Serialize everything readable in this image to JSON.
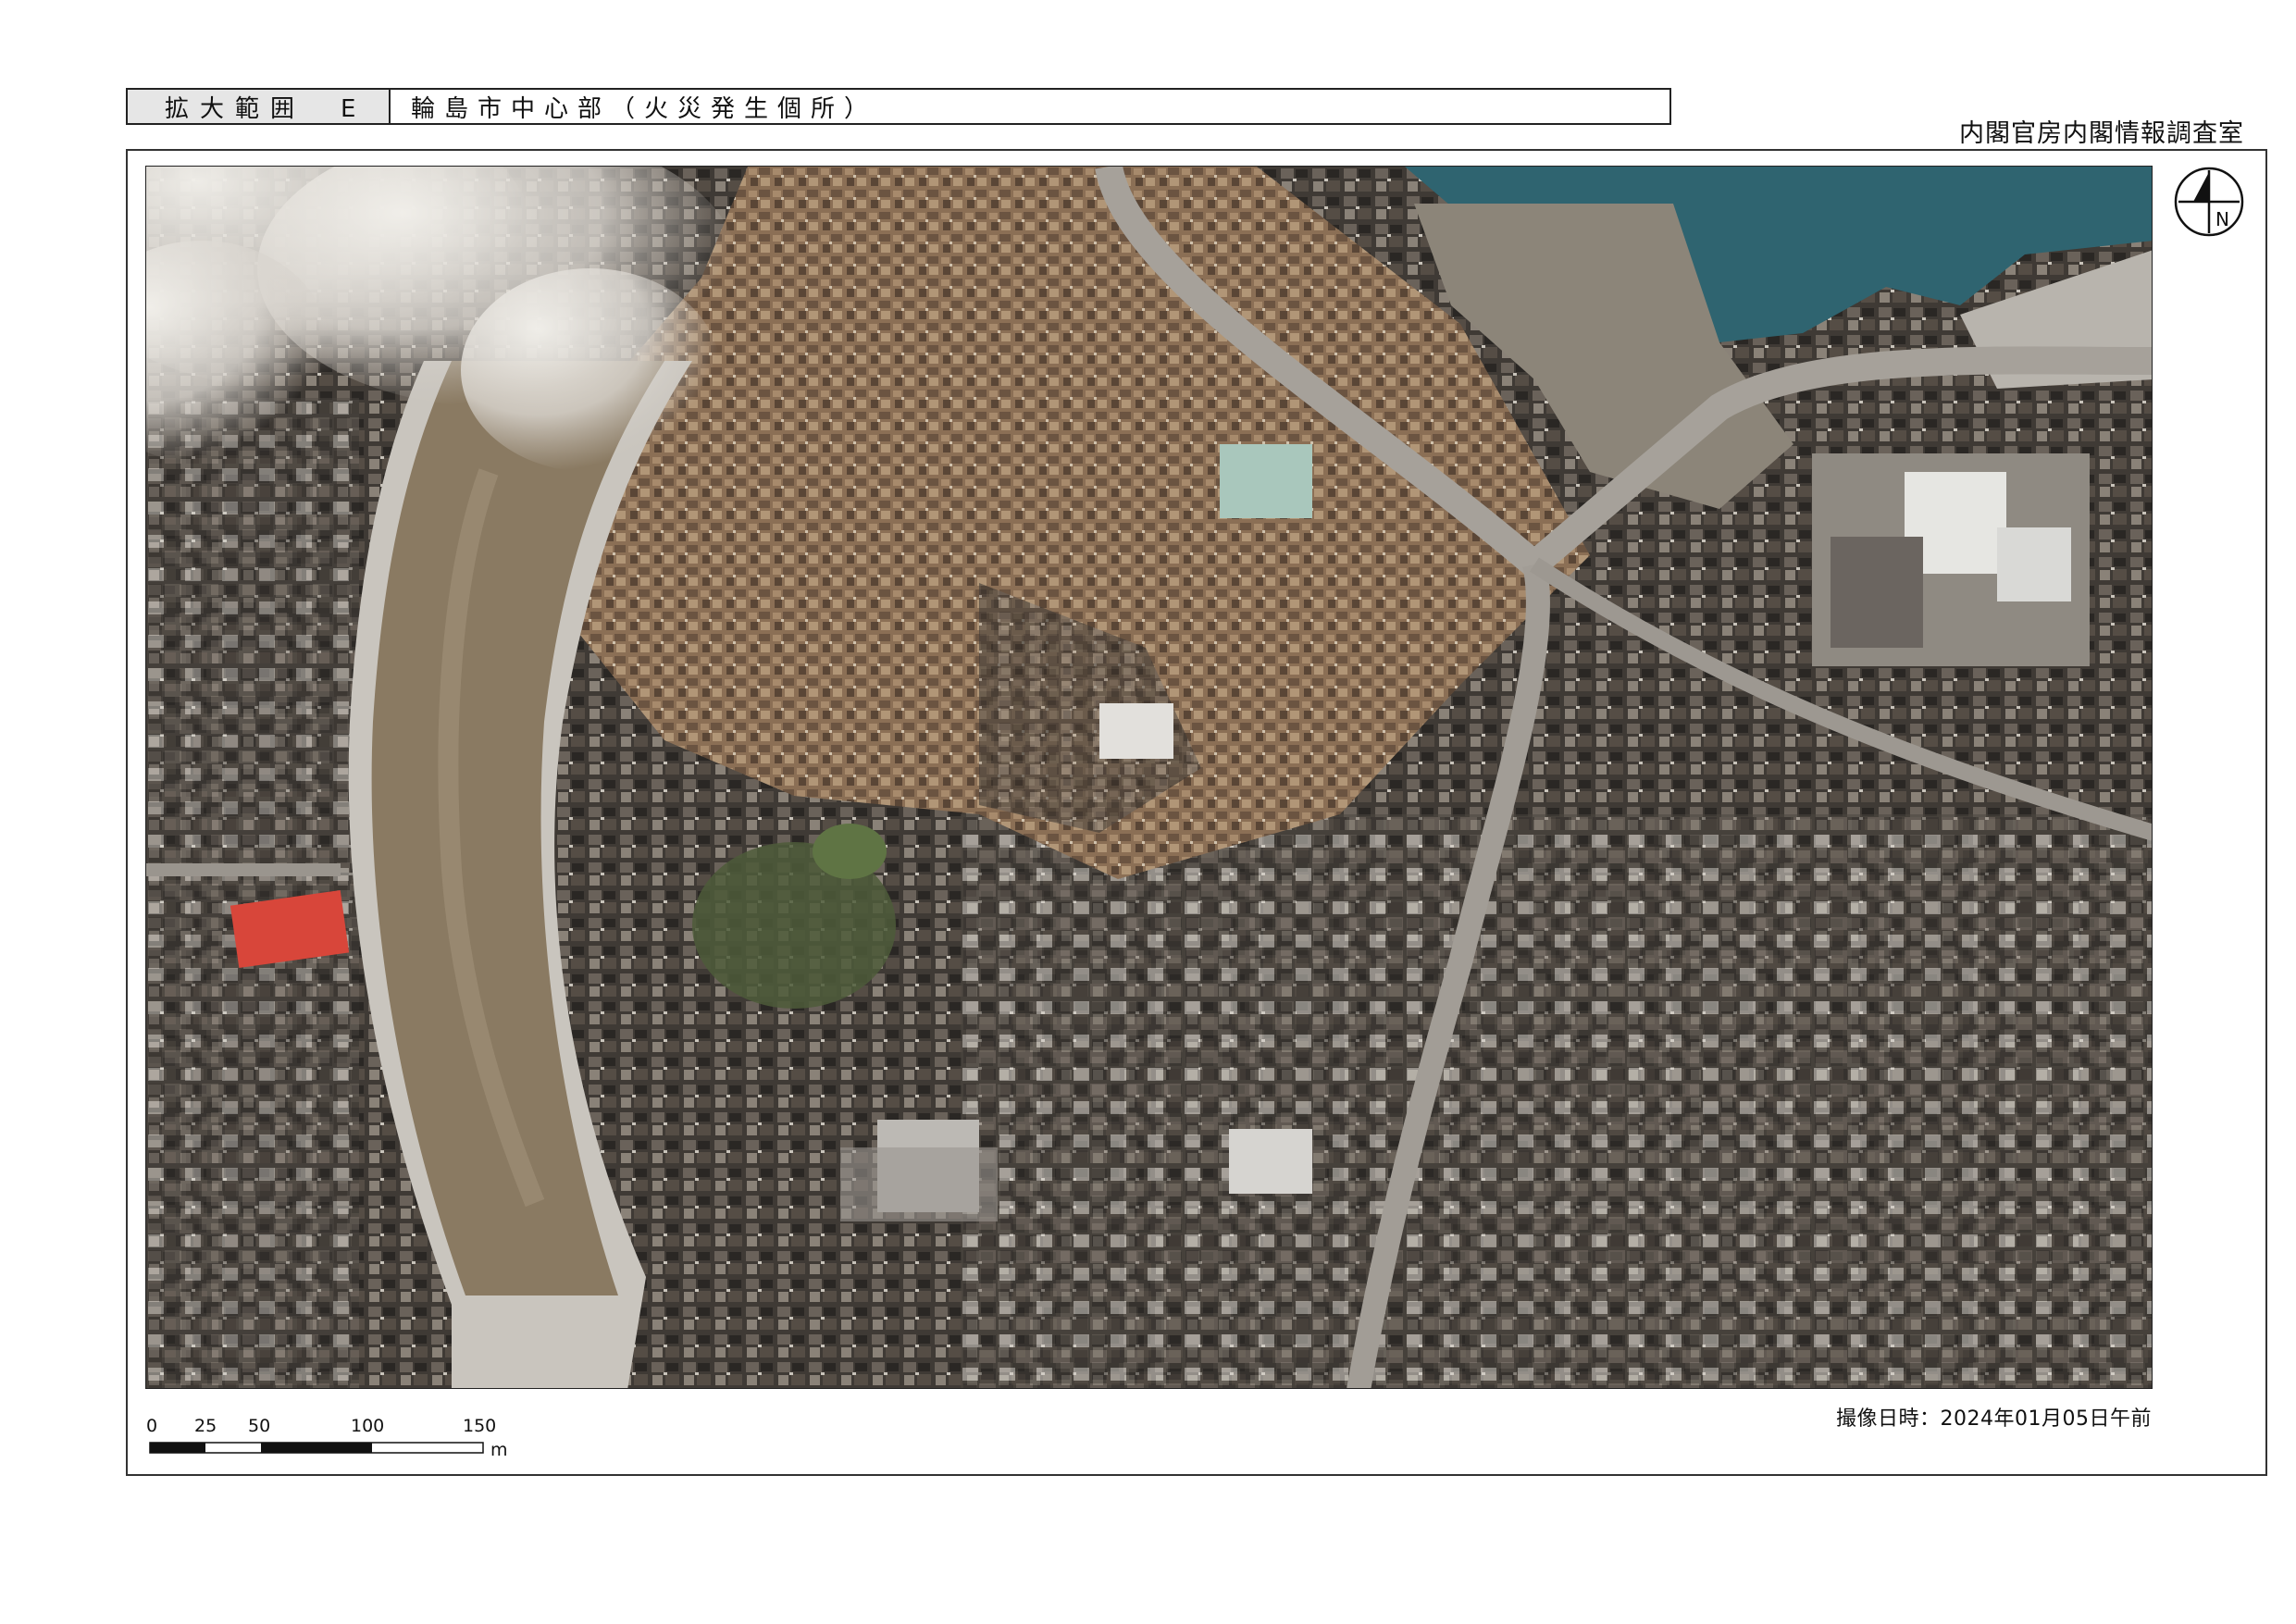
{
  "header": {
    "area_label": "拡大範囲　E",
    "area_title": "輪島市中心部（火災発生個所）"
  },
  "organization": "内閣官房内閣情報調査室",
  "map": {
    "north_label": "N",
    "scale_ticks": [
      "0",
      "25",
      "50",
      "100",
      "150"
    ],
    "scale_unit": "m",
    "capture_datetime": "撮像日時：2024年01月05日午前"
  },
  "colors": {
    "sea": "#2f6470",
    "river": "#8a7a62",
    "burned": "#8e7358",
    "urban": "#4a4540",
    "red_roof": "#d8463a",
    "smoke": "#e9e7e2"
  }
}
